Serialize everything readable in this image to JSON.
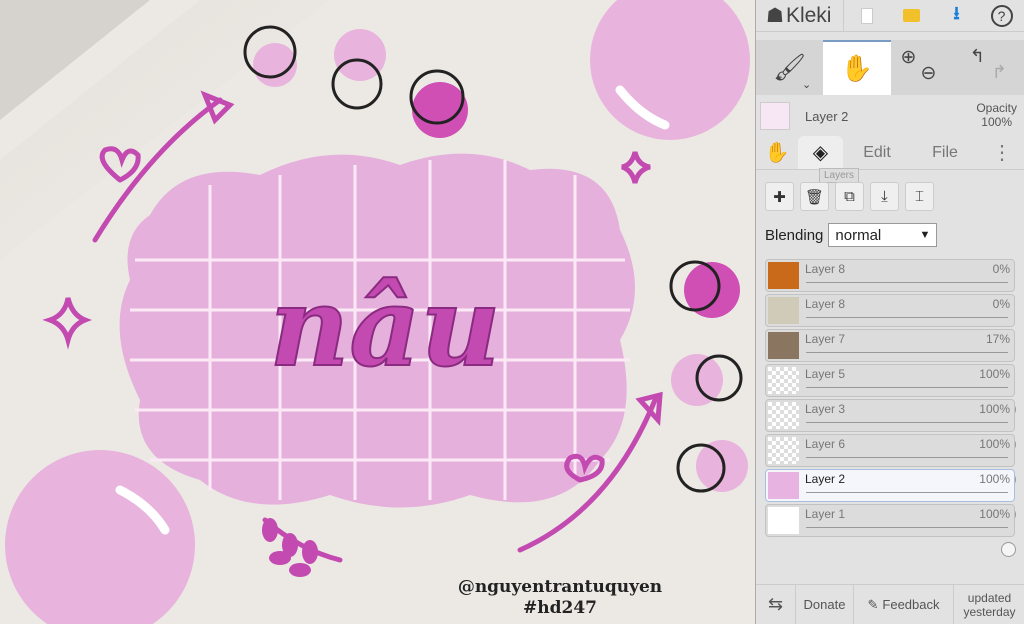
{
  "canvas": {
    "handle": "@nguyentrantuquyen",
    "hashtag": "#hd247",
    "word": "nâu"
  },
  "app": {
    "name": "Kleki"
  },
  "toolbar": {
    "new_icon": "new-file-icon",
    "open_icon": "folder-icon",
    "save_icon": "download-icon",
    "help_icon": "help-icon"
  },
  "current_layer": {
    "name": "Layer 2",
    "opacity_label": "Opacity",
    "opacity": "100%"
  },
  "tabs": {
    "edit": "Edit",
    "file": "File",
    "layers_tooltip": "Layers"
  },
  "blending": {
    "label": "Blending",
    "value": "normal"
  },
  "layers": [
    {
      "name": "Layer 8",
      "opacity": "0%",
      "value": 0,
      "thumb": "#c96a1a"
    },
    {
      "name": "Layer 8",
      "opacity": "0%",
      "value": 0,
      "thumb": "#cfcbb8"
    },
    {
      "name": "Layer 7",
      "opacity": "17%",
      "value": 17,
      "thumb": "#8a7660"
    },
    {
      "name": "Layer 5",
      "opacity": "100%",
      "value": 100
    },
    {
      "name": "Layer 3",
      "opacity": "100%",
      "value": 100
    },
    {
      "name": "Layer 6",
      "opacity": "100%",
      "value": 100
    },
    {
      "name": "Layer 2",
      "opacity": "100%",
      "value": 100,
      "selected": true,
      "thumb": "#e7b3e0"
    },
    {
      "name": "Layer 1",
      "opacity": "100%",
      "value": 100,
      "thumb": "#ffffff"
    }
  ],
  "footer": {
    "donate": "Donate",
    "feedback": "Feedback",
    "updated": "updated yesterday"
  }
}
